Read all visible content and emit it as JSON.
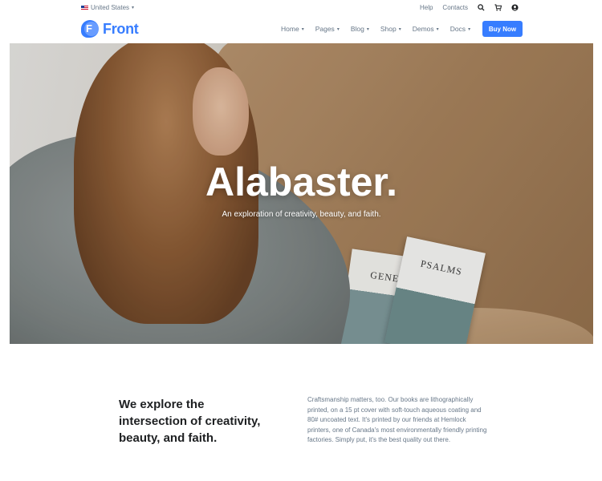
{
  "topbar": {
    "language": "United States",
    "links": [
      "Help",
      "Contacts"
    ],
    "icons": [
      "search-icon",
      "cart-icon",
      "user-icon"
    ]
  },
  "header": {
    "logo_letter": "F",
    "logo_text": "Front",
    "nav": [
      "Home",
      "Pages",
      "Blog",
      "Shop",
      "Demos",
      "Docs"
    ],
    "cta": "Buy Now"
  },
  "hero": {
    "title": "Alabaster.",
    "subtitle": "An exploration of creativity, beauty, and faith.",
    "magazine_left": "GENE",
    "magazine_right": "PSALMS"
  },
  "intro": {
    "heading": "We explore the intersection of creativity, beauty, and faith.",
    "body": "Craftsmanship matters, too. Our books are lithographically printed, on a 15 pt cover with soft-touch aqueous coating and 80# uncoated text. It's printed by our friends at Hemlock printers, one of Canada's most environmentally friendly printing factories. Simply put, it's the best quality out there."
  },
  "colors": {
    "primary": "#377dff",
    "heading": "#1e2022",
    "muted": "#677788"
  }
}
